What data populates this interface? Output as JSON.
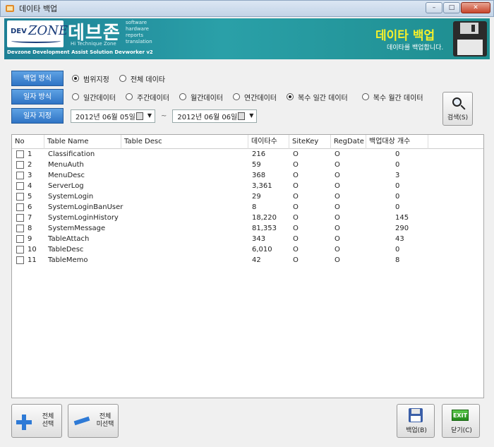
{
  "window": {
    "title": "데이타 백업"
  },
  "banner": {
    "logo_dev": "DEV",
    "logo_zone": "ZONE",
    "brand_name": "데브존",
    "brand_sub": "Hi Technique Zone",
    "brand_words": [
      "software",
      "hardware",
      "reports",
      "translation"
    ],
    "footer": "Devzone Development Assist Solution Devworker v2",
    "title": "데이타 백업",
    "description": "데이타를 백업합니다."
  },
  "options": {
    "backup_mode": {
      "label": "백업 방식",
      "choices": [
        "범위지정",
        "전체 데이타"
      ],
      "selected": 0
    },
    "date_mode": {
      "label": "일자 방식",
      "choices": [
        "일간데이터",
        "주간데이터",
        "월간데이터",
        "연간데이터",
        "복수 일간 데이터",
        "복수 월간 데이터"
      ],
      "selected": 4
    },
    "date_range": {
      "label": "일자 지정",
      "from": "2012년 06월 05일",
      "to": "2012년 06월 06일",
      "separator": "~"
    }
  },
  "search_button": {
    "label": "검색(S)"
  },
  "table": {
    "columns": [
      "No",
      "Table Name",
      "Table Desc",
      "데이타수",
      "SiteKey",
      "RegDate",
      "백업대상 개수"
    ],
    "rows": [
      {
        "no": "1",
        "name": "Classification",
        "desc": "",
        "count": "216",
        "sitekey": "O",
        "regdate": "O",
        "target": "0"
      },
      {
        "no": "2",
        "name": "MenuAuth",
        "desc": "",
        "count": "59",
        "sitekey": "O",
        "regdate": "O",
        "target": "0"
      },
      {
        "no": "3",
        "name": "MenuDesc",
        "desc": "",
        "count": "368",
        "sitekey": "O",
        "regdate": "O",
        "target": "3"
      },
      {
        "no": "4",
        "name": "ServerLog",
        "desc": "",
        "count": "3,361",
        "sitekey": "O",
        "regdate": "O",
        "target": "0"
      },
      {
        "no": "5",
        "name": "SystemLogin",
        "desc": "",
        "count": "29",
        "sitekey": "O",
        "regdate": "O",
        "target": "0"
      },
      {
        "no": "6",
        "name": "SystemLoginBanUser",
        "desc": "",
        "count": "8",
        "sitekey": "O",
        "regdate": "O",
        "target": "0"
      },
      {
        "no": "7",
        "name": "SystemLoginHistory",
        "desc": "",
        "count": "18,220",
        "sitekey": "O",
        "regdate": "O",
        "target": "145"
      },
      {
        "no": "8",
        "name": "SystemMessage",
        "desc": "",
        "count": "81,353",
        "sitekey": "O",
        "regdate": "O",
        "target": "290"
      },
      {
        "no": "9",
        "name": "TableAttach",
        "desc": "",
        "count": "343",
        "sitekey": "O",
        "regdate": "O",
        "target": "43"
      },
      {
        "no": "10",
        "name": "TableDesc",
        "desc": "",
        "count": "6,010",
        "sitekey": "O",
        "regdate": "O",
        "target": "0"
      },
      {
        "no": "11",
        "name": "TableMemo",
        "desc": "",
        "count": "42",
        "sitekey": "O",
        "regdate": "O",
        "target": "8"
      }
    ]
  },
  "buttons": {
    "select_all": [
      "전체",
      "선택"
    ],
    "deselect_all": [
      "전체",
      "미선택"
    ],
    "backup": "백업(B)",
    "close": "닫기(C)",
    "exit_icon_text": "EXIT"
  }
}
